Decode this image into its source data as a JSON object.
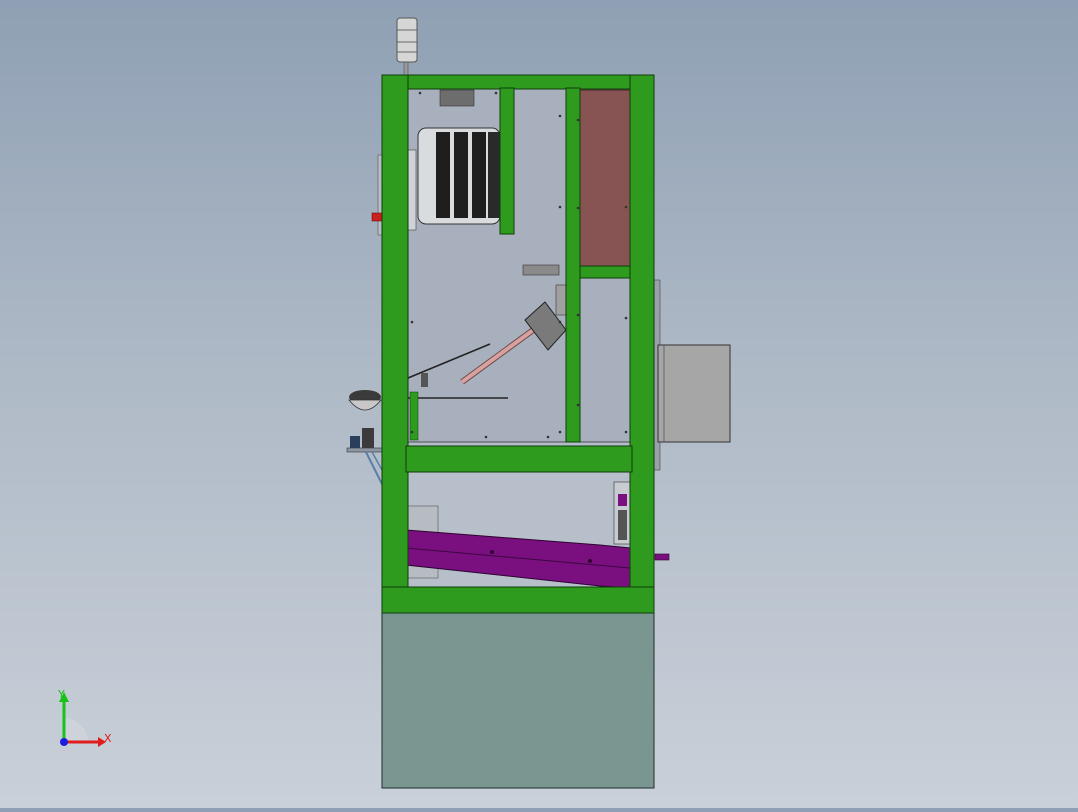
{
  "viewport": {
    "background_top": "#8fa0b4",
    "background_bottom": "#c9d0d9"
  },
  "model": {
    "frame_color": "#2e9a1e",
    "frame_stroke": "#0f3d0a",
    "panel_color": "#a8b0bc",
    "base_color": "#7a9690",
    "chute_color": "#7a0f80",
    "brown_panel_color": "#875353",
    "grey_box_color": "#a3a3a3",
    "signal_tower_color": "#c8c8c8",
    "pink_rod_color": "#d9a0a0"
  },
  "triad": {
    "x_label": "X",
    "y_label": "Y",
    "x_color": "#e01c1c",
    "y_color": "#19c219",
    "z_color": "#1c1ce0"
  }
}
